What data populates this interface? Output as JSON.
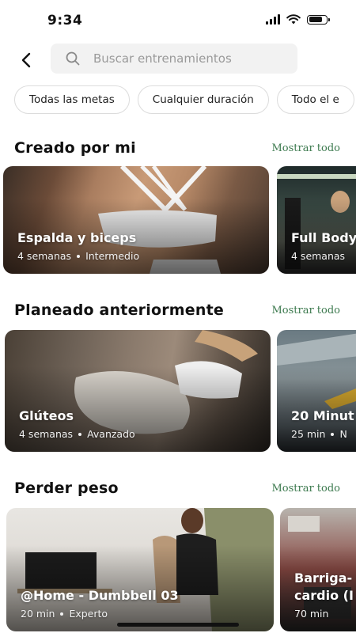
{
  "status": {
    "time": "9:34"
  },
  "search": {
    "placeholder": "Buscar entrenamientos"
  },
  "filters": [
    "Todas las metas",
    "Cualquier duración",
    "Todo el e"
  ],
  "sections": [
    {
      "title": "Creado por mi",
      "more": "Mostrar todo",
      "cards": [
        {
          "title": "Espalda y biceps",
          "duration": "4 semanas",
          "level": "Intermedio"
        },
        {
          "title": "Full Body",
          "duration": "4 semanas",
          "level": ""
        }
      ]
    },
    {
      "title": "Planeado anteriormente",
      "more": "Mostrar todo",
      "cards": [
        {
          "title": "Glúteos",
          "duration": "4 semanas",
          "level": "Avanzado"
        },
        {
          "title": "20 Minut",
          "duration": "25 min",
          "level": "N"
        }
      ]
    },
    {
      "title": "Perder peso",
      "more": "Mostrar todo",
      "cards": [
        {
          "title": "@Home - Dumbbell 03",
          "duration": "20 min",
          "level": "Experto"
        },
        {
          "title": "Barriga-",
          "title2": "cardio (I",
          "duration": "70 min",
          "level": ""
        }
      ]
    }
  ],
  "colors": {
    "accent_link": "#3d7a4f",
    "search_bg": "#f2f2f2",
    "chip_border": "#dcdcdc"
  }
}
